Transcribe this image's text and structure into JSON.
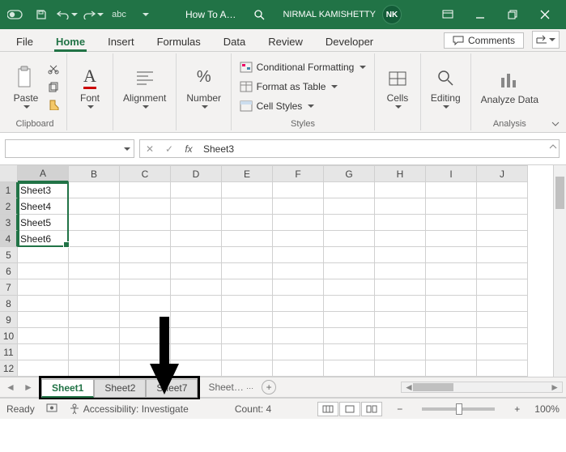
{
  "titlebar": {
    "quick_access": [
      "autosave-off",
      "save",
      "undo",
      "redo",
      "spellcheck"
    ],
    "doc_title": "How To A…",
    "user_name": "NIRMAL KAMISHETTY",
    "user_initials": "NK"
  },
  "tabs": {
    "items": [
      "File",
      "Home",
      "Insert",
      "Formulas",
      "Data",
      "Review",
      "Developer"
    ],
    "active": "Home",
    "comments_label": "Comments"
  },
  "ribbon": {
    "clipboard": {
      "label": "Clipboard",
      "paste": "Paste"
    },
    "font": {
      "label": "Font",
      "btn": "Font"
    },
    "alignment": {
      "label": "Alignment",
      "btn": "Alignment"
    },
    "number": {
      "label": "Number",
      "btn": "Number"
    },
    "styles": {
      "label": "Styles",
      "cond": "Conditional Formatting",
      "table": "Format as Table",
      "cell": "Cell Styles"
    },
    "cells": {
      "label": "Cells",
      "btn": "Cells"
    },
    "editing": {
      "label": "Editing",
      "btn": "Editing"
    },
    "analysis": {
      "label": "Analysis",
      "btn": "Analyze Data"
    }
  },
  "formula_bar": {
    "name_box": "",
    "value": "Sheet3"
  },
  "grid": {
    "columns": [
      "A",
      "B",
      "C",
      "D",
      "E",
      "F",
      "G",
      "H",
      "I",
      "J"
    ],
    "selected_col": "A",
    "rows": [
      {
        "n": 1,
        "cells": [
          "Sheet3",
          "",
          "",
          "",
          "",
          "",
          "",
          "",
          "",
          ""
        ]
      },
      {
        "n": 2,
        "cells": [
          "Sheet4",
          "",
          "",
          "",
          "",
          "",
          "",
          "",
          "",
          ""
        ]
      },
      {
        "n": 3,
        "cells": [
          "Sheet5",
          "",
          "",
          "",
          "",
          "",
          "",
          "",
          "",
          ""
        ]
      },
      {
        "n": 4,
        "cells": [
          "Sheet6",
          "",
          "",
          "",
          "",
          "",
          "",
          "",
          "",
          ""
        ]
      },
      {
        "n": 5,
        "cells": [
          "",
          "",
          "",
          "",
          "",
          "",
          "",
          "",
          "",
          ""
        ]
      },
      {
        "n": 6,
        "cells": [
          "",
          "",
          "",
          "",
          "",
          "",
          "",
          "",
          "",
          ""
        ]
      },
      {
        "n": 7,
        "cells": [
          "",
          "",
          "",
          "",
          "",
          "",
          "",
          "",
          "",
          ""
        ]
      },
      {
        "n": 8,
        "cells": [
          "",
          "",
          "",
          "",
          "",
          "",
          "",
          "",
          "",
          ""
        ]
      },
      {
        "n": 9,
        "cells": [
          "",
          "",
          "",
          "",
          "",
          "",
          "",
          "",
          "",
          ""
        ]
      },
      {
        "n": 10,
        "cells": [
          "",
          "",
          "",
          "",
          "",
          "",
          "",
          "",
          "",
          ""
        ]
      },
      {
        "n": 11,
        "cells": [
          "",
          "",
          "",
          "",
          "",
          "",
          "",
          "",
          "",
          ""
        ]
      },
      {
        "n": 12,
        "cells": [
          "",
          "",
          "",
          "",
          "",
          "",
          "",
          "",
          "",
          ""
        ]
      }
    ],
    "selected_rows": [
      1,
      2,
      3,
      4
    ]
  },
  "sheet_tabs": {
    "boxed": [
      "Sheet1",
      "Sheet2",
      "Sheet7"
    ],
    "active": "Sheet1",
    "overflow": "Sheet…"
  },
  "statusbar": {
    "ready": "Ready",
    "accessibility": "Accessibility: Investigate",
    "count": "Count: 4",
    "zoom": "100%"
  }
}
